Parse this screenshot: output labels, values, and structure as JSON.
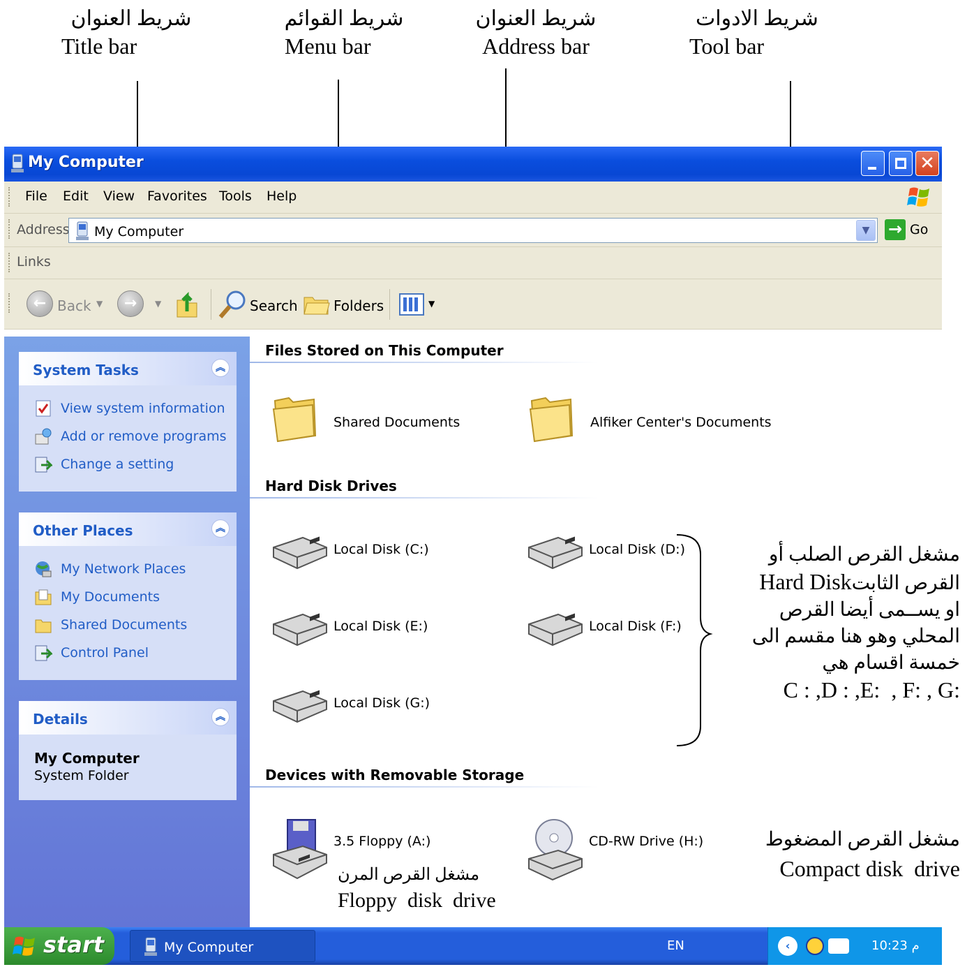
{
  "annotations": {
    "title_bar": {
      "ar": "شريط العنوان",
      "en": "Title bar"
    },
    "menu_bar": {
      "ar": "شريط القوائم",
      "en": "Menu  bar"
    },
    "address_bar": {
      "ar": "شريط العنوان",
      "en": "Address  bar"
    },
    "tool_bar": {
      "ar": "شريط الادوات",
      "en": "Tool  bar"
    },
    "hard_disk_note": {
      "line1": "مشغل القرص الصلب أو",
      "line2_ar": "القرص الثابت",
      "line2_en": " Hard Disk",
      "line3": "او يســمى أيضا القرص",
      "line4": "المحلي وهو هنا مقسم الى",
      "line5": "خمسة اقسام هي",
      "line6": "C : ,D : ,E:  , F: , G:"
    },
    "cd_note": {
      "ar": "مشغل القرص المضغوط",
      "en": "Compact disk  drive"
    },
    "floppy_note": {
      "ar": "مشغل القرص المرن",
      "en": "Floppy  disk  drive"
    }
  },
  "window": {
    "title": "My Computer",
    "menu": [
      "File",
      "Edit",
      "View",
      "Favorites",
      "Tools",
      "Help"
    ],
    "address": {
      "label": "Address",
      "value": "My Computer",
      "go": "Go"
    },
    "links_label": "Links",
    "toolbar": {
      "back": "Back",
      "search": "Search",
      "folders": "Folders"
    }
  },
  "side_panel": {
    "system_tasks": {
      "title": "System Tasks",
      "items": [
        "View system information",
        "Add or remove programs",
        "Change a setting"
      ]
    },
    "other_places": {
      "title": "Other Places",
      "items": [
        "My Network Places",
        "My Documents",
        "Shared Documents",
        "Control Panel"
      ]
    },
    "details": {
      "title": "Details",
      "name": "My Computer",
      "type": "System Folder"
    }
  },
  "content": {
    "files_group": {
      "title": "Files Stored on This Computer",
      "items": [
        "Shared Documents",
        "Alfiker Center's Documents"
      ]
    },
    "hdd_group": {
      "title": "Hard Disk Drives",
      "items": [
        "Local Disk (C:)",
        "Local Disk (D:)",
        "Local Disk (E:)",
        "Local Disk (F:)",
        "Local Disk (G:)"
      ]
    },
    "removable_group": {
      "title": "Devices with Removable Storage",
      "items": [
        "3.5 Floppy (A:)",
        "CD-RW Drive (H:)"
      ]
    }
  },
  "taskbar": {
    "start": "start",
    "window_button": "My Computer",
    "language": "EN",
    "clock": "10:23 م"
  },
  "colors": {
    "title_blue": "#0a4ede",
    "side_panel_blue": "#6375d6",
    "task_link": "#215dc6",
    "start_green": "#3d9e3d"
  }
}
